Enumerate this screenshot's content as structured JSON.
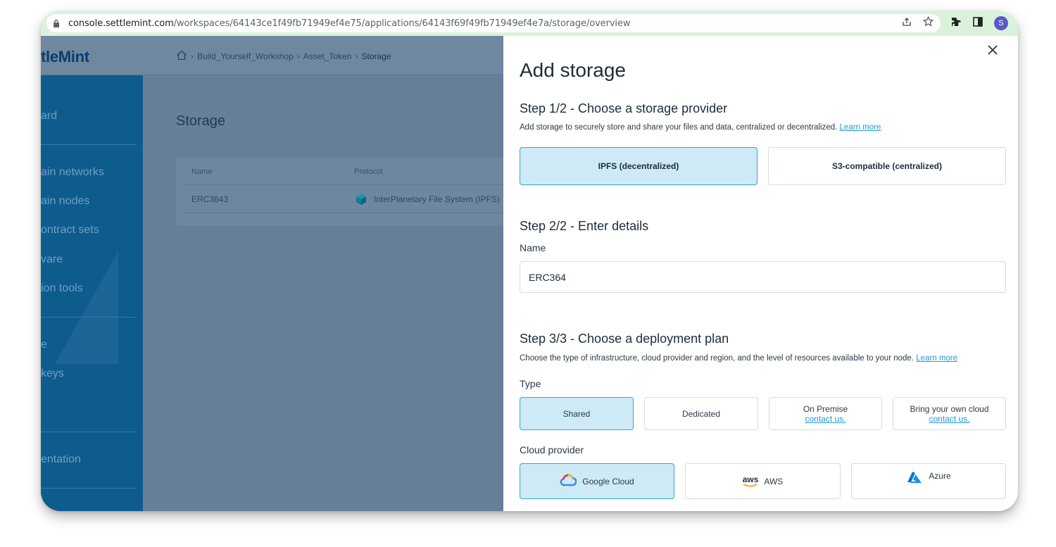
{
  "browser": {
    "url_host": "console.settlemint.com",
    "url_path": "/workspaces/64143ce1f49fb71949ef4e75/applications/64143f69f49fb71949ef4e7a/storage/overview",
    "profile_initial": "S"
  },
  "app": {
    "logo_text": "tleMint",
    "breadcrumb": [
      "Build_Yourself_Workshop",
      "Asset_Token",
      "Storage"
    ],
    "sidebar": {
      "items": [
        "ard",
        "ain networks",
        "ain nodes",
        "ontract sets",
        "vare",
        "ion tools",
        "e",
        "keys",
        "entation"
      ]
    },
    "page_title": "Storage",
    "table": {
      "headers": [
        "Name",
        "Protocol"
      ],
      "rows": [
        [
          "ERC3643",
          "InterPlanetary File System (IPFS)"
        ]
      ]
    }
  },
  "drawer": {
    "title": "Add storage",
    "step1": {
      "title": "Step 1/2 - Choose a storage provider",
      "desc": "Add storage to securely store and share your files and data, centralized or decentralized.",
      "link": "Learn more",
      "options": [
        "IPFS (decentralized)",
        "S3-compatible (centralized)"
      ]
    },
    "step2": {
      "title": "Step 2/2 - Enter details",
      "name_label": "Name",
      "name_value": "ERC364"
    },
    "step3": {
      "title": "Step 3/3 - Choose a deployment plan",
      "desc": "Choose the type of infrastructure, cloud provider and region, and the level of resources available to your node.",
      "link": "Learn more",
      "type_label": "Type",
      "types": [
        "Shared",
        "Dedicated",
        "On Premise",
        "Bring your own cloud"
      ],
      "contact_link": "contact us.",
      "cloud_label": "Cloud provider",
      "providers": [
        "Google Cloud",
        "AWS",
        "Azure"
      ],
      "aws_logo_text": "aws"
    }
  },
  "colors": {
    "selected_bg": "#cdeaf6",
    "selected_border": "#35a5d3",
    "link": "#1f9ad6",
    "overlay": "#67809a",
    "sidebar": "#0e5b8e"
  }
}
